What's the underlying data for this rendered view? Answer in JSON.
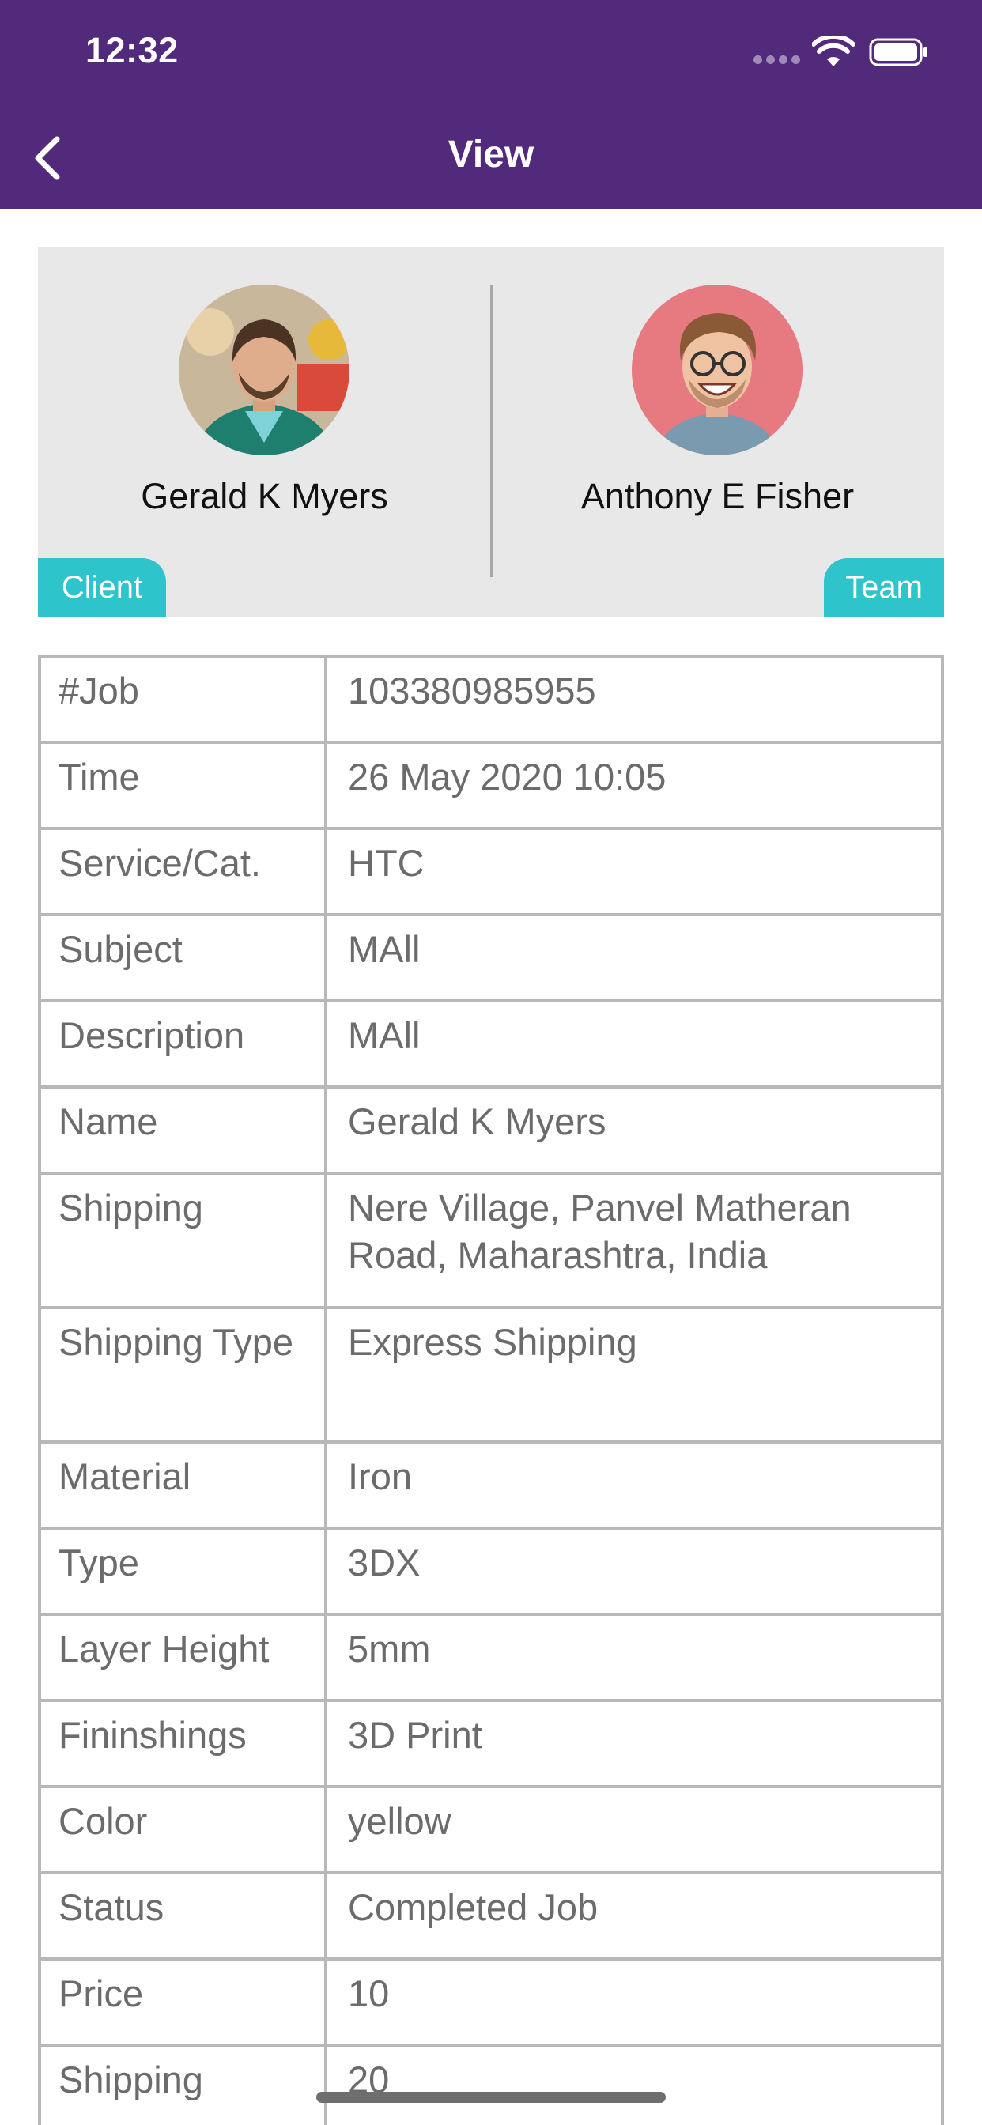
{
  "status_bar": {
    "time": "12:32"
  },
  "nav": {
    "title": "View"
  },
  "participants": {
    "client": {
      "name": "Gerald K Myers",
      "badge": "Client"
    },
    "team": {
      "name": "Anthony E Fisher",
      "badge": "Team"
    }
  },
  "details": [
    {
      "key": "#Job",
      "value": "103380985955"
    },
    {
      "key": "Time",
      "value": "26 May 2020 10:05"
    },
    {
      "key": "Service/Cat.",
      "value": "HTC"
    },
    {
      "key": "Subject",
      "value": "MAll"
    },
    {
      "key": "Description",
      "value": "MAll"
    },
    {
      "key": "Name",
      "value": "Gerald K Myers"
    },
    {
      "key": "Shipping",
      "value": "Nere Village, Panvel Matheran Road, Maharashtra, India"
    },
    {
      "key": "Shipping Type",
      "value": "Express Shipping"
    },
    {
      "key": "Material",
      "value": "Iron"
    },
    {
      "key": "Type",
      "value": "3DX"
    },
    {
      "key": "Layer Height",
      "value": "5mm"
    },
    {
      "key": "Fininshings",
      "value": "3D Print"
    },
    {
      "key": "Color",
      "value": "yellow"
    },
    {
      "key": "Status",
      "value": "Completed Job"
    },
    {
      "key": "Price",
      "value": "10"
    },
    {
      "key": "Shipping",
      "value": "20"
    }
  ],
  "colors": {
    "header": "#522a7c",
    "badge": "#2ec4cc",
    "card_bg": "#e8e8e8",
    "border": "#b8b8b8"
  },
  "icons": [
    "back-chevron-icon",
    "signal-icon",
    "wifi-icon",
    "battery-icon"
  ]
}
